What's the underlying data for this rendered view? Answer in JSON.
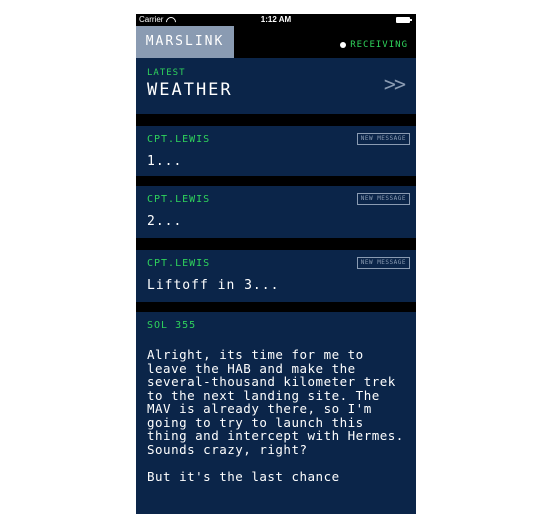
{
  "status": {
    "carrier": "Carrier",
    "time": "1:12 AM"
  },
  "header": {
    "brand": "MARSLINK",
    "receiving": "RECEIVING"
  },
  "weather": {
    "subtitle": "LATEST",
    "title": "WEATHER",
    "chevron": ">>"
  },
  "messages": [
    {
      "from": "CPT.LEWIS",
      "badge": "NEW MESSAGE",
      "text": "1..."
    },
    {
      "from": "CPT.LEWIS",
      "badge": "NEW MESSAGE",
      "text": "2..."
    },
    {
      "from": "CPT.LEWIS",
      "badge": "NEW MESSAGE",
      "text": "Liftoff in 3..."
    }
  ],
  "log": {
    "sol": "SOL 355",
    "paragraph1": "Alright, its time for me to leave the HAB and make the several-thousand kilometer trek to the next landing site. The MAV is already there, so I'm going to try to launch this thing and intercept with Hermes. Sounds crazy, right?",
    "paragraph2": "But it's the last chance"
  },
  "colors": {
    "accent": "#2fd35c",
    "panel": "#0b2549",
    "brand": "#8a9bb2"
  }
}
